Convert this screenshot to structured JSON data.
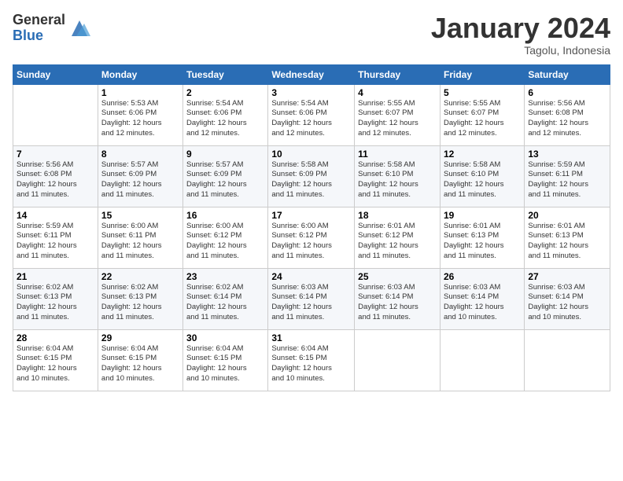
{
  "logo": {
    "general": "General",
    "blue": "Blue"
  },
  "title": "January 2024",
  "subtitle": "Tagolu, Indonesia",
  "header_days": [
    "Sunday",
    "Monday",
    "Tuesday",
    "Wednesday",
    "Thursday",
    "Friday",
    "Saturday"
  ],
  "weeks": [
    [
      {
        "num": "",
        "detail": ""
      },
      {
        "num": "1",
        "detail": "Sunrise: 5:53 AM\nSunset: 6:06 PM\nDaylight: 12 hours\nand 12 minutes."
      },
      {
        "num": "2",
        "detail": "Sunrise: 5:54 AM\nSunset: 6:06 PM\nDaylight: 12 hours\nand 12 minutes."
      },
      {
        "num": "3",
        "detail": "Sunrise: 5:54 AM\nSunset: 6:06 PM\nDaylight: 12 hours\nand 12 minutes."
      },
      {
        "num": "4",
        "detail": "Sunrise: 5:55 AM\nSunset: 6:07 PM\nDaylight: 12 hours\nand 12 minutes."
      },
      {
        "num": "5",
        "detail": "Sunrise: 5:55 AM\nSunset: 6:07 PM\nDaylight: 12 hours\nand 12 minutes."
      },
      {
        "num": "6",
        "detail": "Sunrise: 5:56 AM\nSunset: 6:08 PM\nDaylight: 12 hours\nand 12 minutes."
      }
    ],
    [
      {
        "num": "7",
        "detail": "Sunrise: 5:56 AM\nSunset: 6:08 PM\nDaylight: 12 hours\nand 11 minutes."
      },
      {
        "num": "8",
        "detail": "Sunrise: 5:57 AM\nSunset: 6:09 PM\nDaylight: 12 hours\nand 11 minutes."
      },
      {
        "num": "9",
        "detail": "Sunrise: 5:57 AM\nSunset: 6:09 PM\nDaylight: 12 hours\nand 11 minutes."
      },
      {
        "num": "10",
        "detail": "Sunrise: 5:58 AM\nSunset: 6:09 PM\nDaylight: 12 hours\nand 11 minutes."
      },
      {
        "num": "11",
        "detail": "Sunrise: 5:58 AM\nSunset: 6:10 PM\nDaylight: 12 hours\nand 11 minutes."
      },
      {
        "num": "12",
        "detail": "Sunrise: 5:58 AM\nSunset: 6:10 PM\nDaylight: 12 hours\nand 11 minutes."
      },
      {
        "num": "13",
        "detail": "Sunrise: 5:59 AM\nSunset: 6:11 PM\nDaylight: 12 hours\nand 11 minutes."
      }
    ],
    [
      {
        "num": "14",
        "detail": "Sunrise: 5:59 AM\nSunset: 6:11 PM\nDaylight: 12 hours\nand 11 minutes."
      },
      {
        "num": "15",
        "detail": "Sunrise: 6:00 AM\nSunset: 6:11 PM\nDaylight: 12 hours\nand 11 minutes."
      },
      {
        "num": "16",
        "detail": "Sunrise: 6:00 AM\nSunset: 6:12 PM\nDaylight: 12 hours\nand 11 minutes."
      },
      {
        "num": "17",
        "detail": "Sunrise: 6:00 AM\nSunset: 6:12 PM\nDaylight: 12 hours\nand 11 minutes."
      },
      {
        "num": "18",
        "detail": "Sunrise: 6:01 AM\nSunset: 6:12 PM\nDaylight: 12 hours\nand 11 minutes."
      },
      {
        "num": "19",
        "detail": "Sunrise: 6:01 AM\nSunset: 6:13 PM\nDaylight: 12 hours\nand 11 minutes."
      },
      {
        "num": "20",
        "detail": "Sunrise: 6:01 AM\nSunset: 6:13 PM\nDaylight: 12 hours\nand 11 minutes."
      }
    ],
    [
      {
        "num": "21",
        "detail": "Sunrise: 6:02 AM\nSunset: 6:13 PM\nDaylight: 12 hours\nand 11 minutes."
      },
      {
        "num": "22",
        "detail": "Sunrise: 6:02 AM\nSunset: 6:13 PM\nDaylight: 12 hours\nand 11 minutes."
      },
      {
        "num": "23",
        "detail": "Sunrise: 6:02 AM\nSunset: 6:14 PM\nDaylight: 12 hours\nand 11 minutes."
      },
      {
        "num": "24",
        "detail": "Sunrise: 6:03 AM\nSunset: 6:14 PM\nDaylight: 12 hours\nand 11 minutes."
      },
      {
        "num": "25",
        "detail": "Sunrise: 6:03 AM\nSunset: 6:14 PM\nDaylight: 12 hours\nand 11 minutes."
      },
      {
        "num": "26",
        "detail": "Sunrise: 6:03 AM\nSunset: 6:14 PM\nDaylight: 12 hours\nand 10 minutes."
      },
      {
        "num": "27",
        "detail": "Sunrise: 6:03 AM\nSunset: 6:14 PM\nDaylight: 12 hours\nand 10 minutes."
      }
    ],
    [
      {
        "num": "28",
        "detail": "Sunrise: 6:04 AM\nSunset: 6:15 PM\nDaylight: 12 hours\nand 10 minutes."
      },
      {
        "num": "29",
        "detail": "Sunrise: 6:04 AM\nSunset: 6:15 PM\nDaylight: 12 hours\nand 10 minutes."
      },
      {
        "num": "30",
        "detail": "Sunrise: 6:04 AM\nSunset: 6:15 PM\nDaylight: 12 hours\nand 10 minutes."
      },
      {
        "num": "31",
        "detail": "Sunrise: 6:04 AM\nSunset: 6:15 PM\nDaylight: 12 hours\nand 10 minutes."
      },
      {
        "num": "",
        "detail": ""
      },
      {
        "num": "",
        "detail": ""
      },
      {
        "num": "",
        "detail": ""
      }
    ]
  ]
}
